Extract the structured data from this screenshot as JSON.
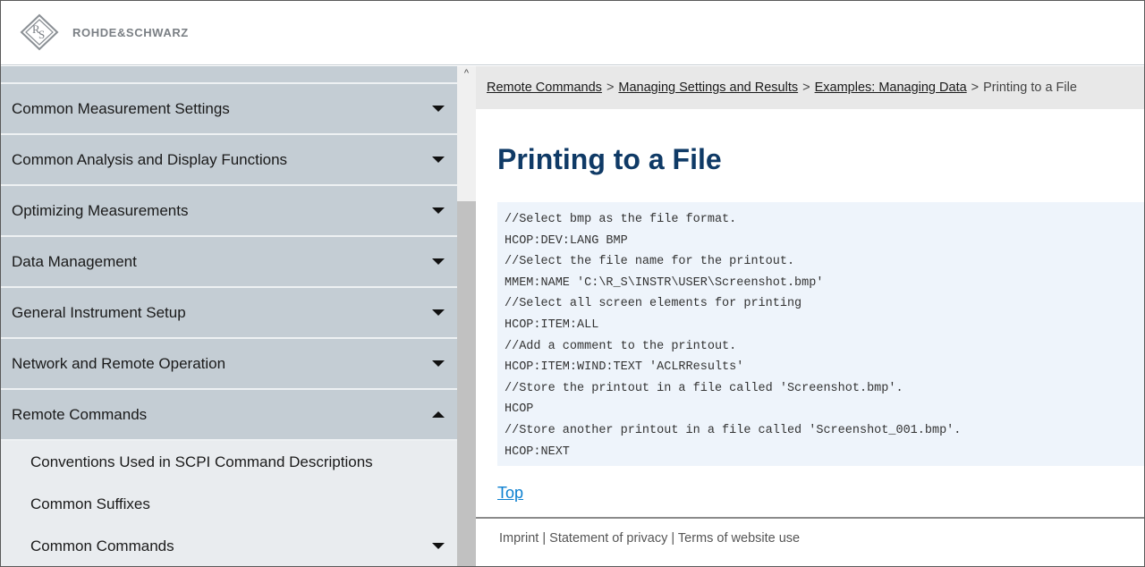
{
  "header": {
    "brand": "ROHDE&SCHWARZ"
  },
  "sidebar": {
    "items": [
      {
        "label": "Common Measurement Settings",
        "state": "collapsed"
      },
      {
        "label": "Common Analysis and Display Functions",
        "state": "collapsed"
      },
      {
        "label": "Optimizing Measurements",
        "state": "collapsed"
      },
      {
        "label": "Data Management",
        "state": "collapsed"
      },
      {
        "label": "General Instrument Setup",
        "state": "collapsed"
      },
      {
        "label": "Network and Remote Operation",
        "state": "collapsed"
      },
      {
        "label": "Remote Commands",
        "state": "expanded"
      }
    ],
    "subitems": [
      {
        "label": "Conventions Used in SCPI Command Descriptions"
      },
      {
        "label": "Common Suffixes"
      },
      {
        "label": "Common Commands",
        "state": "collapsed"
      }
    ]
  },
  "breadcrumb": {
    "links": [
      "Remote Commands",
      "Managing Settings and Results",
      "Examples: Managing Data"
    ],
    "separator": ">",
    "current": "Printing to a File"
  },
  "page": {
    "title": "Printing to a File",
    "code_lines": [
      "//Select bmp as the file format.",
      "HCOP:DEV:LANG BMP",
      "//Select the file name for the printout.",
      "MMEM:NAME 'C:\\R_S\\INSTR\\USER\\Screenshot.bmp'",
      "//Select all screen elements for printing",
      "HCOP:ITEM:ALL",
      "//Add a comment to the printout.",
      "HCOP:ITEM:WIND:TEXT 'ACLRResults'",
      "//Store the printout in a file called 'Screenshot.bmp'.",
      "HCOP",
      "//Store another printout in a file called 'Screenshot_001.bmp'.",
      "HCOP:NEXT"
    ],
    "top_link": "Top"
  },
  "footer": {
    "imprint": "Imprint",
    "privacy": "Statement of privacy",
    "terms": "Terms of website use",
    "separator": "|"
  },
  "colors": {
    "title": "#0f3a66",
    "link": "#0a7fd0",
    "nav_bg": "#c4cdd4",
    "sub_bg": "#e9ecef",
    "code_bg": "#eef4fb"
  }
}
